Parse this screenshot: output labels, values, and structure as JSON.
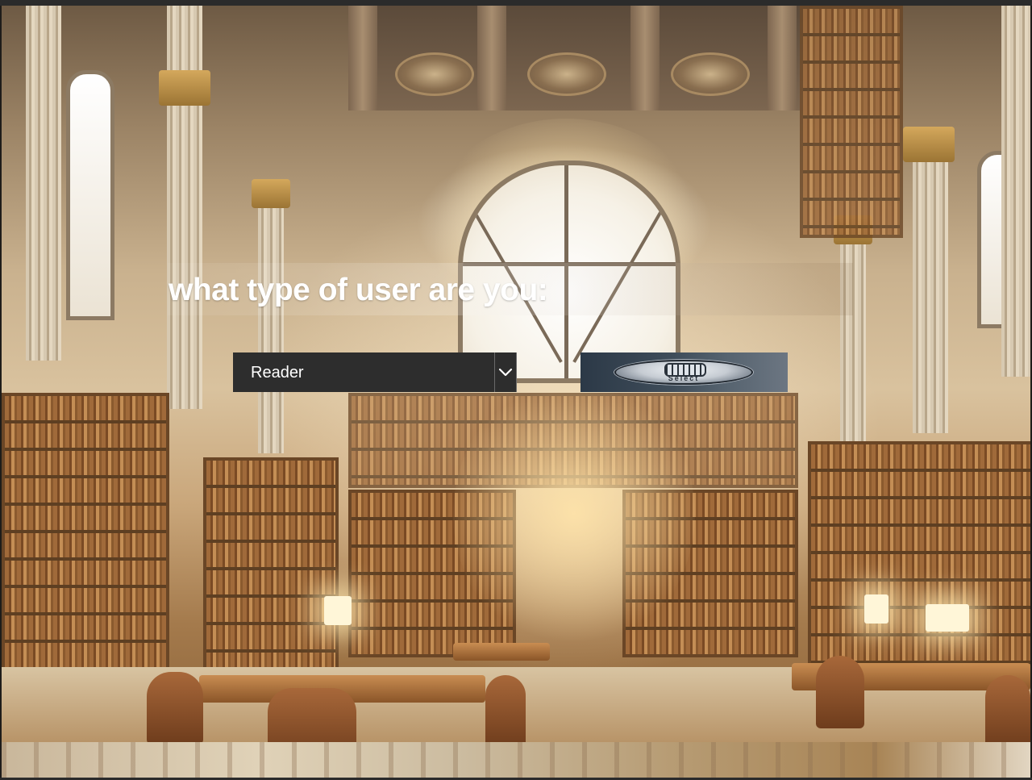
{
  "prompt": {
    "heading": "what type of user are you:"
  },
  "user_type_select": {
    "selected": "Reader",
    "options": [
      "Reader"
    ]
  },
  "select_button": {
    "label": "Select"
  },
  "background": {
    "icon": "library-interior-photo"
  },
  "colors": {
    "select_bg": "#2d2d2d",
    "select_text": "#ffffff",
    "heading_text": "#ffffff",
    "button_bg": "#3f4d5a"
  }
}
